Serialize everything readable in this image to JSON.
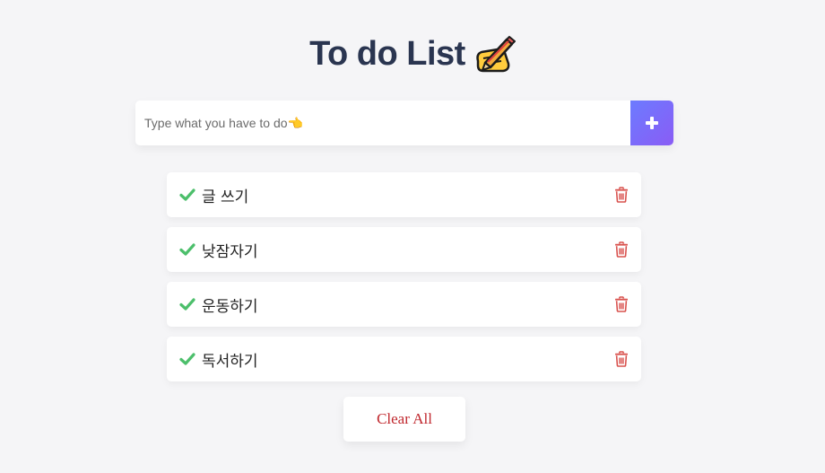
{
  "app": {
    "title": "To do List",
    "title_icon": "writing-hand-icon"
  },
  "input": {
    "placeholder": "Type what you have to do👈",
    "value": "",
    "add_icon": "plus-icon"
  },
  "todos": [
    {
      "text": "글 쓰기",
      "check_icon": "check-icon",
      "delete_icon": "trash-icon"
    },
    {
      "text": "낮잠자기",
      "check_icon": "check-icon",
      "delete_icon": "trash-icon"
    },
    {
      "text": "운동하기",
      "check_icon": "check-icon",
      "delete_icon": "trash-icon"
    },
    {
      "text": "독서하기",
      "check_icon": "check-icon",
      "delete_icon": "trash-icon"
    }
  ],
  "footer": {
    "clear_label": "Clear All"
  },
  "colors": {
    "background": "#f5f5f7",
    "title": "#2a3550",
    "check": "#4cbf6b",
    "trash": "#d9534f",
    "clear_text": "#c0272d",
    "add_button_start": "#6c7bff",
    "add_button_end": "#8a5cf5"
  }
}
